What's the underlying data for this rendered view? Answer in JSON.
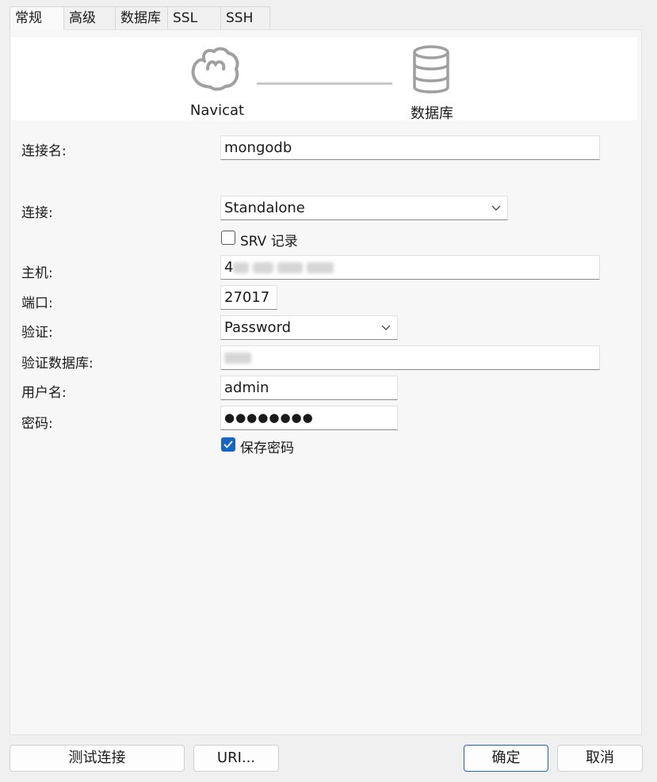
{
  "tabs": [
    "常规",
    "高级",
    "数据库",
    "SSL",
    "SSH"
  ],
  "header": {
    "left_label": "Navicat",
    "right_label": "数据库"
  },
  "form": {
    "connection_name_label": "连接名:",
    "connection_name_value": "mongodb",
    "connection_type_label": "连接:",
    "connection_type_value": "Standalone",
    "srv_label": "SRV 记录",
    "srv_checked": false,
    "host_label": "主机:",
    "host_value_visible": "4",
    "port_label": "端口:",
    "port_value": "27017",
    "auth_label": "验证:",
    "auth_value": "Password",
    "auth_db_label": "验证数据库:",
    "username_label": "用户名:",
    "username_value": "admin",
    "password_label": "密码:",
    "password_mask": "●●●●●●●●",
    "save_password_label": "保存密码",
    "save_password_checked": true
  },
  "buttons": {
    "test": "测试连接",
    "uri": "URI...",
    "ok": "确定",
    "cancel": "取消"
  },
  "colors": {
    "accent": "#1766c4",
    "icon_gray": "#a0a0a0"
  }
}
